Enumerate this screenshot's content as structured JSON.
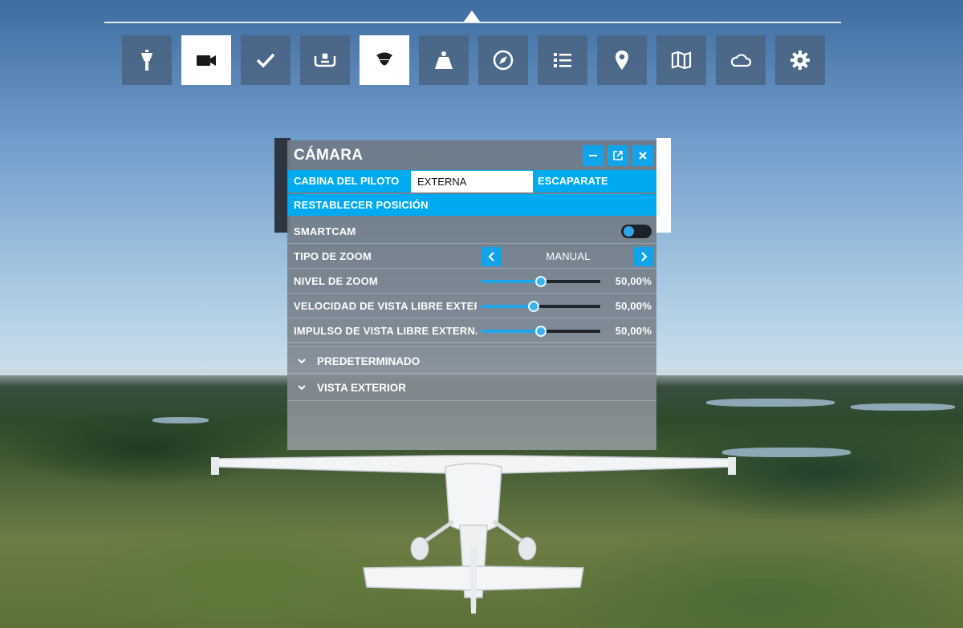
{
  "toolbar": {
    "items": [
      {
        "icon": "tower-icon",
        "active": false
      },
      {
        "icon": "camera-icon",
        "active": true
      },
      {
        "icon": "checkmark-icon",
        "active": false
      },
      {
        "icon": "yoke-icon",
        "active": false
      },
      {
        "icon": "pilot-icon",
        "active": true
      },
      {
        "icon": "weight-icon",
        "active": false
      },
      {
        "icon": "compass-icon",
        "active": false
      },
      {
        "icon": "list-icon",
        "active": false
      },
      {
        "icon": "map-pin-icon",
        "active": false
      },
      {
        "icon": "map-icon",
        "active": false
      },
      {
        "icon": "cloud-icon",
        "active": false
      },
      {
        "icon": "gear-icon",
        "active": false
      }
    ]
  },
  "panel": {
    "title": "CÁMARA",
    "header_buttons": [
      "minimize-icon",
      "popout-icon",
      "close-icon"
    ],
    "tabs": [
      {
        "label": "CABINA DEL PILOTO",
        "selected": false
      },
      {
        "label": "EXTERNA",
        "selected": true
      },
      {
        "label": "ESCAPARATE",
        "selected": false
      }
    ],
    "reset_label": "RESTABLECER POSICIÓN",
    "settings": {
      "smartcam": {
        "label": "SMARTCAM",
        "on": false
      },
      "zoom_type": {
        "label": "TIPO DE ZOOM",
        "value": "MANUAL"
      },
      "zoom_level": {
        "label": "NIVEL DE ZOOM",
        "fraction": 0.5,
        "value": "50,00%"
      },
      "free_speed": {
        "label": "VELOCIDAD DE VISTA LIBRE EXTERNA",
        "fraction": 0.44,
        "value": "50,00%"
      },
      "free_impulse": {
        "label": "IMPULSO DE VISTA LIBRE EXTERNA",
        "fraction": 0.5,
        "value": "50,00%"
      }
    },
    "sections": [
      {
        "label": "PREDETERMINADO"
      },
      {
        "label": "VISTA EXTERIOR"
      }
    ]
  },
  "colors": {
    "accent": "#00aaf0",
    "toolbar_button": "#4a6482",
    "toolbar_active": "#ffffff"
  }
}
